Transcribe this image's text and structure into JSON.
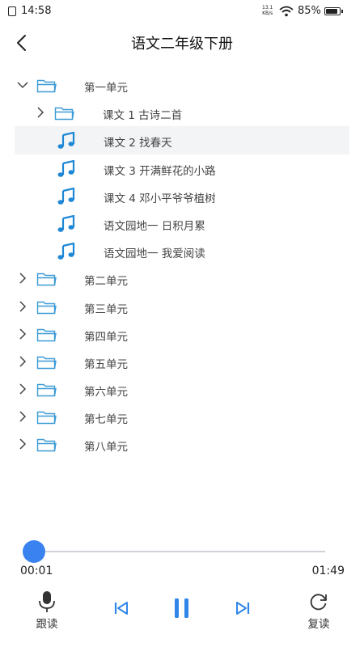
{
  "status": {
    "time": "14:58",
    "speed_top": "13.1",
    "speed_bottom": "KB/s",
    "battery": "85%"
  },
  "header": {
    "title": "语文二年级下册"
  },
  "tree": {
    "unit1": {
      "label": "第一单元"
    },
    "lesson1": {
      "label": "课文 1 古诗二首"
    },
    "items": [
      {
        "label": "课文 2 找春天"
      },
      {
        "label": "课文 3 开满鲜花的小路"
      },
      {
        "label": "课文 4 邓小平爷爷植树"
      },
      {
        "label": "语文园地一 日积月累"
      },
      {
        "label": "语文园地一 我爱阅读"
      }
    ],
    "units": [
      {
        "label": "第二单元"
      },
      {
        "label": "第三单元"
      },
      {
        "label": "第四单元"
      },
      {
        "label": "第五单元"
      },
      {
        "label": "第六单元"
      },
      {
        "label": "第七单元"
      },
      {
        "label": "第八单元"
      }
    ]
  },
  "player": {
    "current": "00:01",
    "total": "01:49",
    "progress": 0.01
  },
  "controls": {
    "follow_read": "跟读",
    "repeat": "复读"
  },
  "colors": {
    "accent": "#3a82f0",
    "folder": "#3b9bd6",
    "note": "#1e88d6"
  }
}
